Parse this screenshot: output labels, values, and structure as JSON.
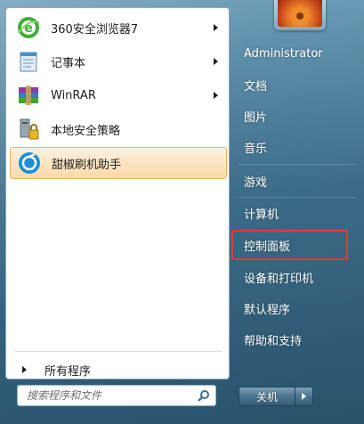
{
  "programs": [
    {
      "label": "360安全浏览器7",
      "icon": "browser-360-icon",
      "has_submenu": true
    },
    {
      "label": "记事本",
      "icon": "notepad-icon",
      "has_submenu": true
    },
    {
      "label": "WinRAR",
      "icon": "winrar-icon",
      "has_submenu": true
    },
    {
      "label": "本地安全策略",
      "icon": "security-policy-icon",
      "has_submenu": false
    },
    {
      "label": "甜椒刷机助手",
      "icon": "tianjiao-flash-icon",
      "has_submenu": false,
      "highlighted": true
    }
  ],
  "all_programs_label": "所有程序",
  "search": {
    "placeholder": "搜索程序和文件"
  },
  "right_pane": {
    "user": "Administrator",
    "documents": "文档",
    "pictures": "图片",
    "music": "音乐",
    "games": "游戏",
    "computer": "计算机",
    "control_panel": "控制面板",
    "devices_printers": "设备和打印机",
    "default_programs": "默认程序",
    "help_support": "帮助和支持"
  },
  "shutdown": {
    "label": "关机"
  },
  "colors": {
    "highlight_frame": "#e23b3b",
    "selected_bg": "#fbd9a8",
    "menu_bg": "#3f6f8c"
  }
}
